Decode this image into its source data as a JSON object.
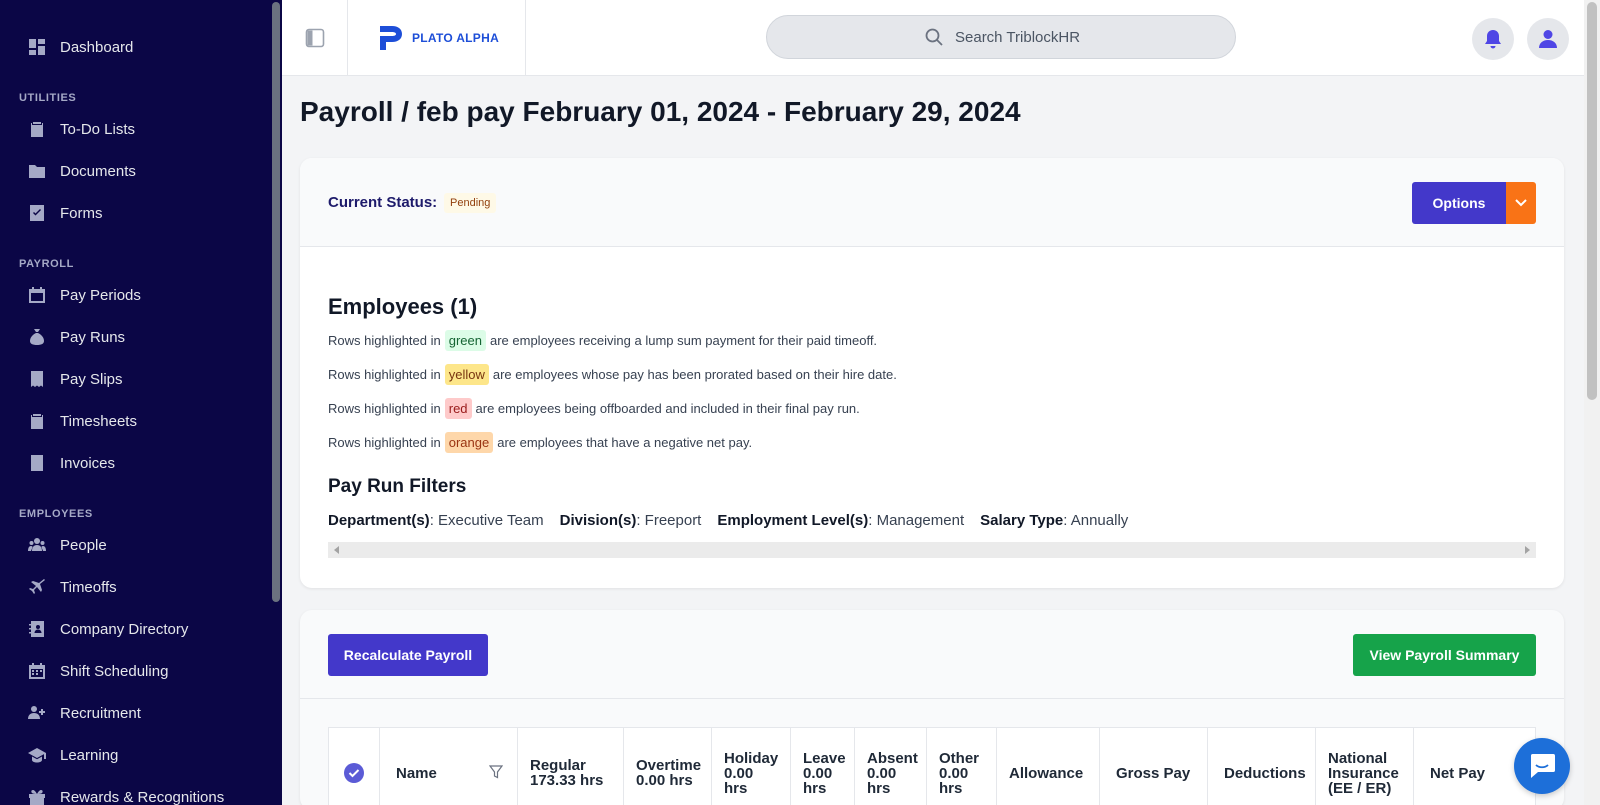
{
  "sidebar": {
    "dashboard": "Dashboard",
    "sections": {
      "utilities": "UTILITIES",
      "payroll": "PAYROLL",
      "employees": "EMPLOYEES"
    },
    "items": {
      "todo": "To-Do Lists",
      "documents": "Documents",
      "forms": "Forms",
      "pay_periods": "Pay Periods",
      "pay_runs": "Pay Runs",
      "pay_slips": "Pay Slips",
      "timesheets": "Timesheets",
      "invoices": "Invoices",
      "people": "People",
      "timeoffs": "Timeoffs",
      "company_directory": "Company Directory",
      "shift_scheduling": "Shift Scheduling",
      "recruitment": "Recruitment",
      "learning": "Learning",
      "rewards": "Rewards & Recognitions"
    }
  },
  "header": {
    "logo_text": "PLATO ALPHA",
    "search_placeholder": "Search TriblockHR"
  },
  "page": {
    "title": "Payroll / feb pay February 01, 2024 - February 29, 2024"
  },
  "status": {
    "label": "Current Status:",
    "value": "Pending",
    "options_label": "Options"
  },
  "employees": {
    "title": "Employees (1)",
    "legend": [
      {
        "prefix": "Rows highlighted in",
        "color_word": "green",
        "suffix": "are employees receiving a lump sum payment for their paid timeoff."
      },
      {
        "prefix": "Rows highlighted in",
        "color_word": "yellow",
        "suffix": "are employees whose pay has been prorated based on their hire date."
      },
      {
        "prefix": "Rows highlighted in",
        "color_word": "red",
        "suffix": "are employees being offboarded and included in their final pay run."
      },
      {
        "prefix": "Rows highlighted in",
        "color_word": "orange",
        "suffix": "are employees that have a negative net pay."
      }
    ]
  },
  "filters": {
    "title": "Pay Run Filters",
    "items": [
      {
        "label": "Department(s)",
        "value": ": Executive Team"
      },
      {
        "label": "Division(s)",
        "value": ": Freeport"
      },
      {
        "label": "Employment Level(s)",
        "value": ": Management"
      },
      {
        "label": "Salary Type",
        "value": ": Annually"
      }
    ]
  },
  "actions": {
    "recalculate": "Recalculate Payroll",
    "view_summary": "View Payroll Summary"
  },
  "table": {
    "headers": {
      "name": "Name",
      "regular": [
        "Regular",
        "173.33 hrs"
      ],
      "overtime": [
        "Overtime",
        "0.00 hrs"
      ],
      "holiday": [
        "Holiday",
        "0.00",
        "hrs"
      ],
      "leave": [
        "Leave",
        "0.00",
        "hrs"
      ],
      "absent": [
        "Absent",
        "0.00",
        "hrs"
      ],
      "other": [
        "Other",
        "0.00",
        "hrs"
      ],
      "allowance": "Allowance",
      "gross_pay": "Gross Pay",
      "deductions": "Deductions",
      "national_insurance": [
        "National",
        "Insurance",
        "(EE / ER)"
      ],
      "net_pay": "Net Pay"
    }
  },
  "colors": {
    "sidebar_bg": "#0b0646",
    "primary": "#4338ca",
    "accent_orange": "#f97316",
    "success": "#16a34a"
  }
}
